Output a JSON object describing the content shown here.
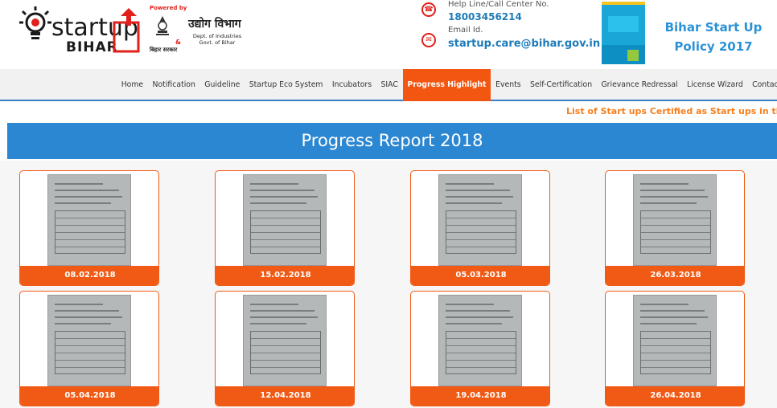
{
  "header": {
    "logo_text": "startup",
    "logo_sub": "BIHAR",
    "powered_by": "Powered by",
    "udyog": "उद्योग विभाग",
    "amp": "&",
    "dept_line1": "Dept. of Industries",
    "dept_line2": "Govt. of Bihar",
    "bihar_sarkar": "बिहार सरकार",
    "helpline_label": "Help Line/Call Center No.",
    "helpline_number": "18003456214",
    "email_label": "Email Id.",
    "email": "startup.care@bihar.gov.in",
    "policy_line1": "Bihar Start Up",
    "policy_line2": "Policy 2017"
  },
  "nav": {
    "items": [
      {
        "label": "Home"
      },
      {
        "label": "Notification"
      },
      {
        "label": "Guideline"
      },
      {
        "label": "Startup Eco System"
      },
      {
        "label": "Incubators"
      },
      {
        "label": "SIAC"
      },
      {
        "label": "Progress Highlight",
        "active": true
      },
      {
        "label": "Events"
      },
      {
        "label": "Self-Certification"
      },
      {
        "label": "Grievance Redressal"
      },
      {
        "label": "License Wizard"
      },
      {
        "label": "Contact Us"
      }
    ]
  },
  "ticker": {
    "text": "List of Start ups Certified as Start ups in the me"
  },
  "page": {
    "title": "Progress Report 2018"
  },
  "reports": [
    {
      "date": "08.02.2018"
    },
    {
      "date": "15.02.2018"
    },
    {
      "date": "05.03.2018"
    },
    {
      "date": "26.03.2018"
    },
    {
      "date": "05.04.2018"
    },
    {
      "date": "12.04.2018"
    },
    {
      "date": "19.04.2018"
    },
    {
      "date": "26.04.2018"
    }
  ],
  "colors": {
    "accent_orange": "#f05a15",
    "banner_blue": "#2b87d2",
    "link_blue": "#1c7bb9",
    "ticker_orange": "#f77f1e"
  },
  "icons": {
    "phone": "phone-icon",
    "email": "mail-icon"
  }
}
